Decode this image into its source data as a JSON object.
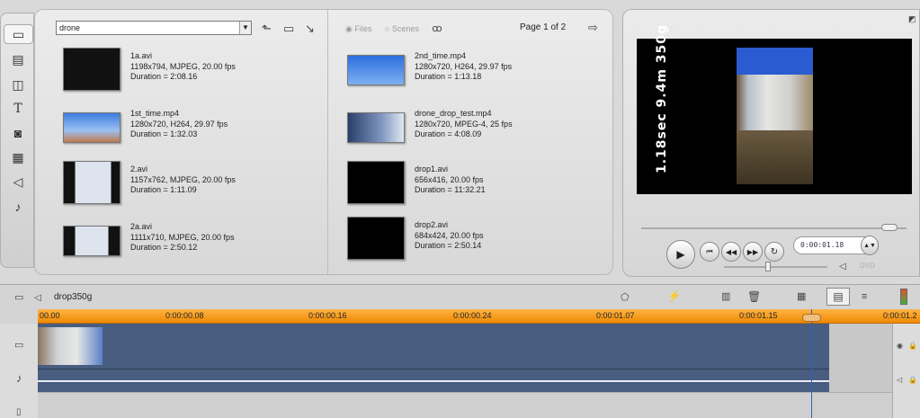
{
  "album": {
    "folder_value": "drone",
    "radio_files": "Files",
    "radio_scenes": "Scenes",
    "page_label": "Page 1 of 2",
    "clips_left": [
      {
        "name": "1a.avi",
        "spec": "1198x794, MJPEG, 20.00 fps",
        "duration": "Duration = 2:08.16"
      },
      {
        "name": "1st_time.mp4",
        "spec": "1280x720, H264, 29.97 fps",
        "duration": "Duration = 1:32.03"
      },
      {
        "name": "2.avi",
        "spec": "1157x762, MJPEG, 20.00 fps",
        "duration": "Duration = 1:11.09"
      },
      {
        "name": "2a.avi",
        "spec": "1111x710, MJPEG, 20.00 fps",
        "duration": "Duration = 2:50.12"
      }
    ],
    "clips_right": [
      {
        "name": "2nd_time.mp4",
        "spec": "1280x720, H264, 29.97 fps",
        "duration": "Duration = 1:13.18"
      },
      {
        "name": "drone_drop_test.mp4",
        "spec": "1280x720, MPEG-4, 25 fps",
        "duration": "Duration = 4:08.09"
      },
      {
        "name": "drop1.avi",
        "spec": "656x416, 20.00 fps",
        "duration": "Duration = 11:32.21"
      },
      {
        "name": "drop2.avi",
        "spec": "684x424, 20.00 fps",
        "duration": "Duration = 2:50.14"
      }
    ]
  },
  "preview": {
    "overlay_text": "1.18sec 9.4m 350g",
    "timecode": "0:00:01.18",
    "dvd_label": "DVD"
  },
  "timeline": {
    "project_name": "drop350g",
    "ruler_ticks": [
      "00.00",
      "0:00:00.08",
      "0:00:00.16",
      "0:00:00.24",
      "0:00:01.07",
      "0:00:01.15",
      "0:00:01.2"
    ]
  }
}
